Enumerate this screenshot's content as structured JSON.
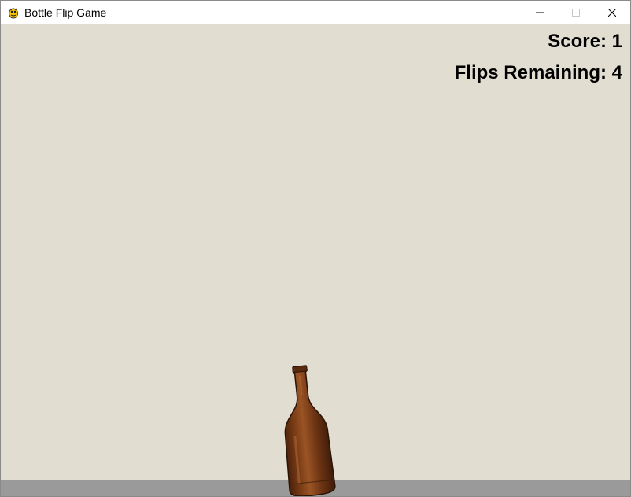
{
  "window": {
    "title": "Bottle Flip Game",
    "app_icon": "pygame-snake-icon",
    "controls": [
      "minimize-icon",
      "maximize-icon",
      "close-icon"
    ]
  },
  "hud": {
    "score_text": "Score: 1",
    "flips_text": "Flips Remaining: 4"
  },
  "game": {
    "score": 1,
    "flips_remaining": 4,
    "bottle_state": "standing, slightly tilted",
    "colors": {
      "background": "#e2ddd1",
      "floor": "#9a9a9a",
      "bottle": "#6e3514",
      "text": "#000000"
    }
  }
}
